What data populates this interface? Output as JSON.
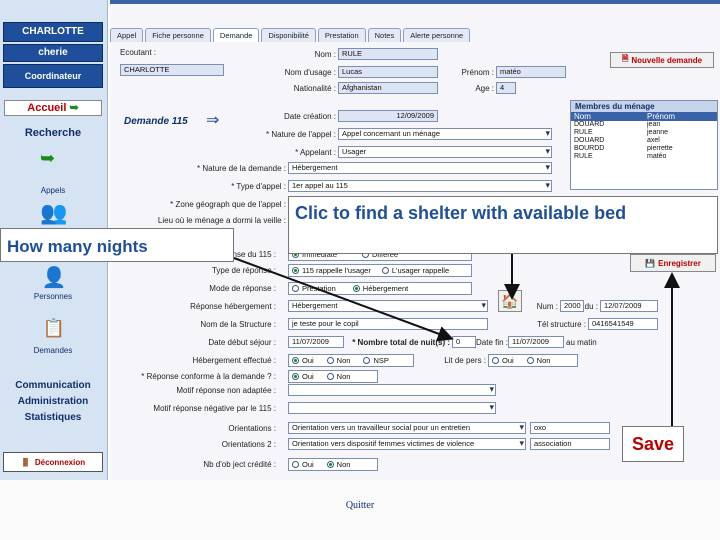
{
  "sidebar": {
    "user_name": "CHARLOTTE",
    "user_sub": "cherie",
    "role": "Coordinateur",
    "home": "Accueil",
    "search": "Recherche",
    "appels": "Appels",
    "personnes": "Personnes",
    "demandes": "Demandes",
    "communication": "Communication",
    "administration": "Administration",
    "statistiques": "Statistiques",
    "logout": "Déconnexion"
  },
  "tabs": [
    "Appel",
    "Fiche personne",
    "Demande",
    "Disponibilité",
    "Prestation",
    "Notes",
    "Alerte personne"
  ],
  "header": {
    "ecoutant_label": "Ecoutant :",
    "ecoutant_value": "CHARLOTTE",
    "nom_label": "Nom :",
    "nom_value": "RULE",
    "nom_usage_label": "Nom d'usage :",
    "nom_usage_value": "Lucas",
    "prenom_label": "Prénom :",
    "prenom_value": "matéo",
    "nationalite_label": "Nationalité :",
    "nationalite_value": "Afghanistan",
    "age_label": "Age :",
    "age_value": "4",
    "new_request": "Nouvelle demande"
  },
  "request": {
    "title": "Demande 115",
    "date_creation_label": "Date création :",
    "date_creation_value": "12/09/2009",
    "nature_appel_label": "* Nature de l'appel :",
    "nature_appel_value": "Appel concernant un ménage",
    "appelant_label": "* Appelant :",
    "appelant_value": "Usager",
    "nature_demande_label": "* Nature de la demande :",
    "nature_demande_value": "Hébergement",
    "type_appel_label": "* Type d'appel :",
    "type_appel_value": "1er appel au 115",
    "zone_label": "* Zone géograph que de l'appel :",
    "lieu_label": "Lieu où le ménage a dormi la veille :"
  },
  "response": {
    "reponse_115_label": "Réponse du 115 :",
    "reponse_115_options": [
      "Immédiate",
      "Différée"
    ],
    "type_reponse_label": "Type de réponse :",
    "type_reponse_options": [
      "115 rappelle l'usager",
      "L'usager rappelle"
    ],
    "mode_label": "Mode de réponse :",
    "mode_options": [
      "Prestation",
      "Hébergement"
    ],
    "heb_label": "Réponse hébergement :",
    "heb_value": "Hébergement",
    "structure_label": "Nom de la Structure :",
    "structure_value": "je teste pour le copil",
    "date_debut_label": "Date début séjour :",
    "date_debut_value": "11/07/2009",
    "nuits_label": "* Nombre total de nuit(s) :",
    "nuits_value": "0",
    "date_fin_label": "Date fin :",
    "date_fin_value": "11/07/2009",
    "au_matin": "au matin",
    "num_label": "Num :",
    "num_value": "2000",
    "du_label": "du :",
    "du_value": "12/07/2009",
    "tel_label": "Tél structure :",
    "tel_value": "0416541549",
    "heb_effectue_label": "Hébergement effectué :",
    "heb_effectue_options": [
      "Oui",
      "Non",
      "NSP"
    ],
    "lit_label": "Lit de pers :",
    "lit_options": [
      "Oui",
      "Non"
    ],
    "positive_label": "* Réponse conforme à la demande ? :",
    "positive_options": [
      "Oui",
      "Non"
    ],
    "motif_adaptee_label": "Motif réponse non adaptée :",
    "motif_negative_label": "Motif réponse négative par le 115 :",
    "orientation_label": "Orientations :",
    "orientation_value": "Orientation vers un travailleur social pour un entretien",
    "orientation_extra": "oxo",
    "orientation2_label": "Orientations 2 :",
    "orientation2_value": "Orientation vers dispositif femmes victimes de violence",
    "orientation2_extra": "association",
    "credit_label": "Nb d'ob ject crédité :",
    "credit_options": [
      "Oui",
      "Non"
    ],
    "save": "Enregistrer"
  },
  "members": {
    "title": "Membres du ménage",
    "col_nom": "Nom",
    "col_prenom": "Prénom",
    "rows": [
      [
        "DOUARD",
        "jean"
      ],
      [
        "RULE",
        "jeanne"
      ],
      [
        "DOUARD",
        "axel"
      ],
      [
        "BOURDD",
        "pierrette"
      ],
      [
        "RULE",
        "matéo"
      ]
    ]
  },
  "callouts": {
    "nights": "How many nights",
    "shelter": "Clic to find a shelter with available bed",
    "save": "Save"
  },
  "footer": {
    "quit": "Quitter"
  },
  "colors": {
    "accent": "#1f4f9a",
    "alert": "#b00000"
  }
}
